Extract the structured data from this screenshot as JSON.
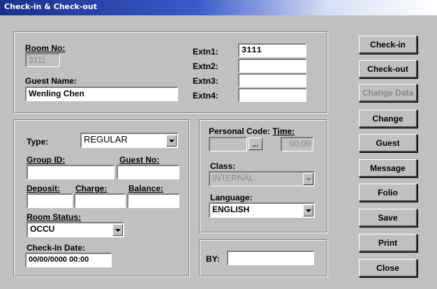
{
  "window": {
    "title": "Check-in & Check-out"
  },
  "room": {
    "room_no_label": "Room No:",
    "room_no_value": "3111",
    "guest_name_label": "Guest Name:",
    "guest_name_value": "Wenling Chen",
    "extn1_label": "Extn1:",
    "extn1_value": "3111",
    "extn2_label": "Extn2:",
    "extn2_value": "",
    "extn3_label": "Extn3:",
    "extn3_value": "",
    "extn4_label": "Extn4:",
    "extn4_value": ""
  },
  "details": {
    "type_label": "Type:",
    "type_value": "REGULAR",
    "group_id_label": "Group ID:",
    "group_id_value": "",
    "guest_no_label": "Guest No:",
    "guest_no_value": "",
    "deposit_label": "Deposit:",
    "deposit_value": "",
    "charge_label": "Charge:",
    "charge_value": "",
    "balance_label": "Balance:",
    "balance_value": "",
    "room_status_label": "Room Status:",
    "room_status_value": "OCCU",
    "checkin_date_label": "Check-In Date:",
    "checkin_date_value": "00/00/0000 00:00"
  },
  "personal": {
    "code_label": "Personal Code:",
    "time_label": "Time:",
    "code_value": "",
    "browse_label": "...",
    "time_value": "00:00",
    "class_label": "Class:",
    "class_value": "INTERNAL",
    "language_label": "Language:",
    "language_value": "ENGLISH"
  },
  "by": {
    "label": "BY:",
    "value": ""
  },
  "buttons": {
    "checkin": "Check-in",
    "checkout": "Check-out",
    "change_data": "Change Data",
    "change": "Change",
    "guest": "Guest",
    "message": "Message",
    "folio": "Folio",
    "save": "Save",
    "print": "Print",
    "close": "Close"
  }
}
